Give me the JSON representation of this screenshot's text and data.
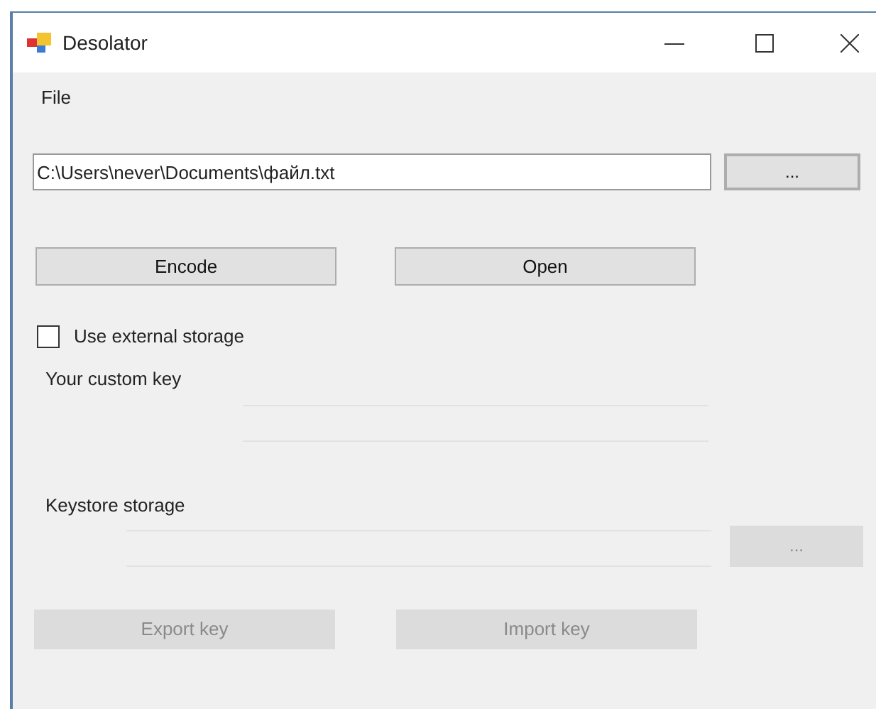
{
  "window": {
    "title": "Desolator"
  },
  "menu": [
    {
      "label": "File"
    }
  ],
  "file_path": {
    "value": "C:\\Users\\never\\Documents\\файл.txt"
  },
  "browse_button": {
    "label": "...",
    "disabled": false,
    "focused": true
  },
  "actions": [
    {
      "label": "Encode",
      "disabled": false
    },
    {
      "label": "Open",
      "disabled": false
    }
  ],
  "use_external_storage": {
    "label": "Use external storage",
    "checked": false
  },
  "custom_key": {
    "label": "Your custom key",
    "disabled": true
  },
  "keystore": {
    "label": "Keystore storage",
    "disabled": true
  },
  "keystore_browse": {
    "label": "...",
    "disabled": true
  },
  "key_actions": [
    {
      "label": "Export key",
      "disabled": true
    },
    {
      "label": "Import key",
      "disabled": true
    }
  ]
}
